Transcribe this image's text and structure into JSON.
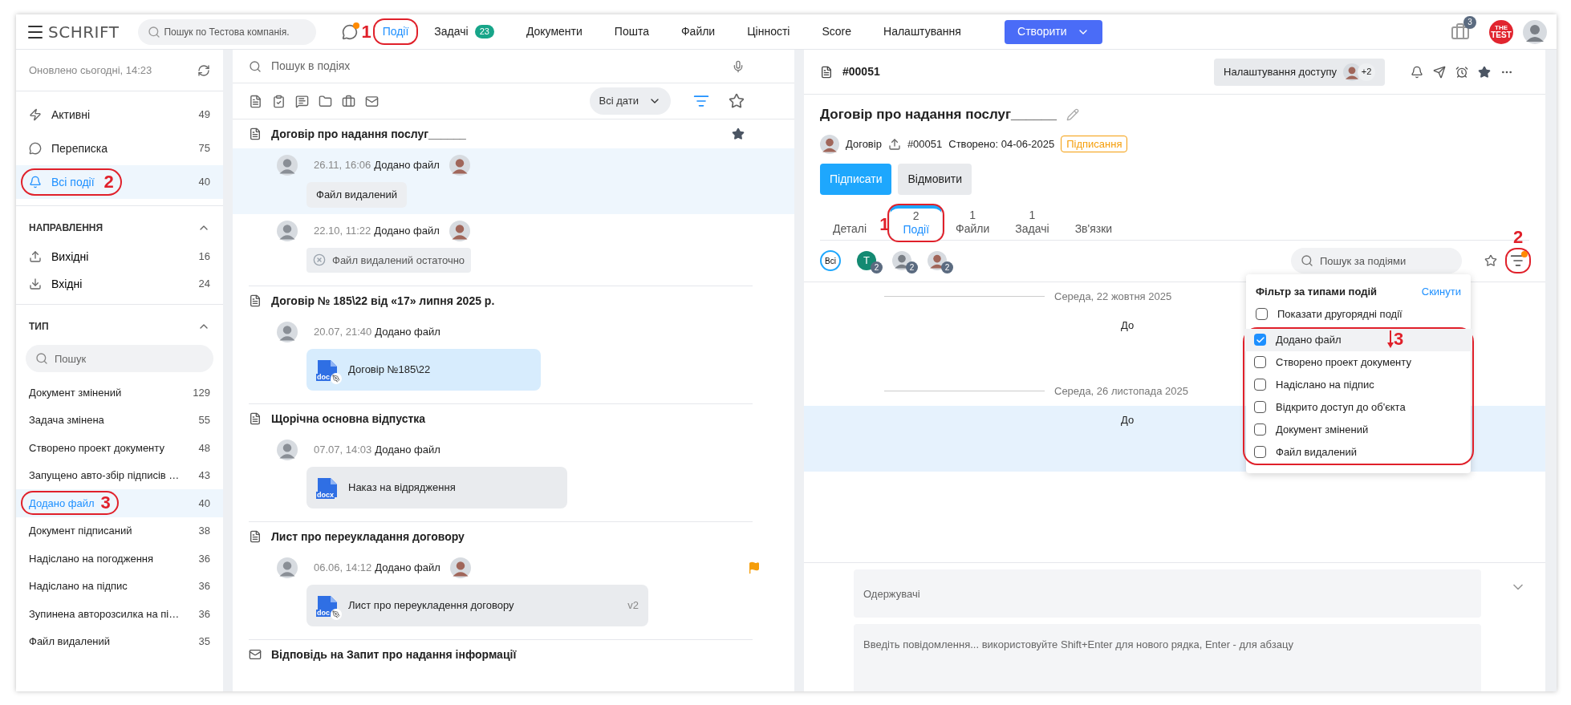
{
  "topbar": {
    "logo": "SCHRIFT",
    "search": {
      "placeholder": "Пошук по Тестова компанія."
    },
    "notify_dot": true,
    "nav": [
      {
        "label": "Події",
        "selected": true,
        "callout": "1"
      },
      {
        "label": "Задачі",
        "selected": false,
        "badge": "23"
      },
      {
        "label": "Документи",
        "selected": false
      },
      {
        "label": "Пошта",
        "selected": false
      },
      {
        "label": "Файли",
        "selected": false
      },
      {
        "label": "Цінності",
        "selected": false
      },
      {
        "label": "Score",
        "selected": false
      },
      {
        "label": "Налаштування",
        "selected": false
      }
    ],
    "create_button": "Створити",
    "briefcase_badge": "3",
    "company_logo": [
      "THE",
      "TEST"
    ]
  },
  "sidebar": {
    "updated": "Оновлено сьогодні, 14:23",
    "items": [
      {
        "label": "Активні",
        "count": "49",
        "selected": false
      },
      {
        "label": "Переписка",
        "count": "75",
        "selected": false
      },
      {
        "label": "Всі події",
        "count": "40",
        "selected": true,
        "callout": "2"
      }
    ],
    "direction": {
      "title": "НАПРАВЛЕННЯ",
      "expanded": true,
      "items": [
        {
          "label": "Вихідні",
          "count": "16"
        },
        {
          "label": "Вхідні",
          "count": "24"
        }
      ]
    },
    "type": {
      "title": "ТИП",
      "expanded": true,
      "search": {
        "placeholder": "Пошук"
      },
      "items": [
        {
          "label": "Документ змінений",
          "count": "129",
          "selected": false
        },
        {
          "label": "Задача змінена",
          "count": "55",
          "selected": false
        },
        {
          "label": "Створено проект документу",
          "count": "48",
          "selected": false
        },
        {
          "label": "Запущено авто-збір підписів …",
          "count": "43",
          "selected": false
        },
        {
          "label": "Додано файл",
          "count": "40",
          "selected": true,
          "callout": "3"
        },
        {
          "label": "Документ підписаний",
          "count": "38",
          "selected": false
        },
        {
          "label": "Надіслано на погодження",
          "count": "36",
          "selected": false
        },
        {
          "label": "Надіслано на підпис",
          "count": "36",
          "selected": false
        },
        {
          "label": "Зупинена авторозсилка на пі…",
          "count": "36",
          "selected": false
        },
        {
          "label": "Файл видалений",
          "count": "35",
          "selected": false
        }
      ]
    }
  },
  "events": {
    "search": {
      "placeholder": "Пошук в подіях"
    },
    "date_filter": "Всі дати",
    "groups": [
      {
        "kind": "document",
        "title": "Договір про надання послуг______",
        "starred": true,
        "events": [
          {
            "time": "26.11, 16:06",
            "action": "Додано файл",
            "recipient": true,
            "highlighted": true,
            "flagged": false,
            "attachment": {
              "kind": "note",
              "name": "Файл видалений"
            }
          },
          {
            "time": "22.10, 11:22",
            "action": "Додано файл",
            "recipient": true,
            "highlighted": false,
            "flagged": false,
            "attachment": {
              "kind": "deleted",
              "name": "Файл видалений остаточно"
            }
          }
        ]
      },
      {
        "kind": "document",
        "title": "Договір № 185\\22 від «17» липня 2025 р.",
        "starred": false,
        "events": [
          {
            "time": "20.07, 21:40",
            "action": "Додано файл",
            "recipient": false,
            "highlighted": false,
            "flagged": false,
            "attachment": {
              "kind": "file",
              "name": "Договір №185\\22",
              "file_type": "doc",
              "signed": true,
              "selected": true
            }
          }
        ]
      },
      {
        "kind": "document",
        "title": "Щорічна основна відпустка",
        "starred": false,
        "events": [
          {
            "time": "07.07, 14:03",
            "action": "Додано файл",
            "recipient": false,
            "highlighted": false,
            "flagged": false,
            "attachment": {
              "kind": "file",
              "name": "Наказ на відрядження",
              "file_type": "docx",
              "signed": false,
              "selected": false
            }
          }
        ]
      },
      {
        "kind": "document",
        "title": "Лист про переукладання договору",
        "starred": false,
        "events": [
          {
            "time": "06.06, 14:12",
            "action": "Додано файл",
            "recipient": true,
            "highlighted": false,
            "flagged": true,
            "attachment": {
              "kind": "file",
              "name": "Лист про переукладення договору",
              "file_type": "doc",
              "signed": true,
              "selected": false,
              "version": "v2"
            }
          }
        ]
      },
      {
        "kind": "mail",
        "title": "Відповідь на Запит про надання інформації",
        "starred": false
      }
    ]
  },
  "document": {
    "number": "#00051",
    "access_button": "Налаштування доступу",
    "access_more": "+2",
    "title": "Договір про надання послуг______",
    "doc_type": "Договір",
    "doc_number": "#00051",
    "created": "Створено: 04-06-2025",
    "status": "Підписання",
    "buttons": [
      {
        "kind": "primary",
        "label": "Підписати"
      },
      {
        "kind": "secondary",
        "label": "Відмовити"
      }
    ],
    "tabs": [
      {
        "label": "Деталі",
        "selected": false
      },
      {
        "count": "2",
        "label": "Події",
        "selected": true,
        "callout": "1"
      },
      {
        "count": "1",
        "label": "Файли",
        "selected": false
      },
      {
        "count": "1",
        "label": "Задачі",
        "selected": false
      },
      {
        "label": "Зв'язки",
        "selected": false
      }
    ],
    "participants": {
      "all": "Всі",
      "people": [
        {
          "initial": "T",
          "count": "2"
        },
        {
          "count": "2"
        },
        {
          "count": "2"
        }
      ]
    },
    "event_search": {
      "placeholder": "Пошук за подіями"
    },
    "filter_active": true,
    "filter_callout": "2",
    "timeline": [
      {
        "date": "Середа, 22 жовтня 2025",
        "text": "До",
        "highlighted": false
      },
      {
        "date": "Середа, 26 листопада 2025",
        "text": "До",
        "highlighted": true
      }
    ],
    "filter_menu": {
      "title": "Фільтр за типами подій",
      "reset": "Скинути",
      "callout": "3",
      "options": [
        {
          "label": "Показати другорядні події",
          "checked": false,
          "group": false,
          "selected": false
        },
        {
          "label": "Додано файл",
          "checked": true,
          "group": true,
          "selected": true
        },
        {
          "label": "Створено проект документу",
          "checked": false,
          "group": true,
          "selected": false
        },
        {
          "label": "Надіслано на підпис",
          "checked": false,
          "group": true,
          "selected": false
        },
        {
          "label": "Відкрито доступ до об'єкта",
          "checked": false,
          "group": true,
          "selected": false
        },
        {
          "label": "Документ змінений",
          "checked": false,
          "group": true,
          "selected": false
        },
        {
          "label": "Файл видалений",
          "checked": false,
          "group": true,
          "selected": false
        }
      ]
    },
    "composer": {
      "recipients": {
        "placeholder": "Одержувачі"
      },
      "message": {
        "placeholder": "Введіть повідомлення... використовуйте Shift+Enter для нового рядка, Enter - для абзацу"
      }
    }
  }
}
